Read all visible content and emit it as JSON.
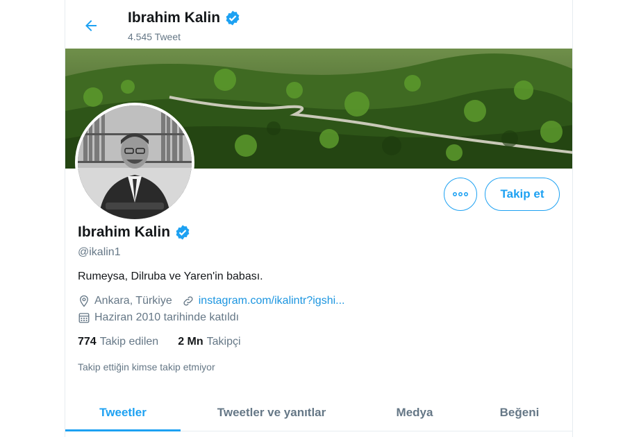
{
  "header": {
    "name": "Ibrahim Kalin",
    "tweet_count": "4.545 Tweet"
  },
  "profile": {
    "name": "Ibrahim Kalin",
    "handle": "@ikalin1",
    "bio": "Rumeysa, Dilruba ve Yaren'in babası.",
    "location": "Ankara, Türkiye",
    "website": "instagram.com/ikalintr?igshi...",
    "joined": "Haziran 2010 tarihinde katıldı",
    "following_count": "774",
    "following_label": "Takip edilen",
    "followers_count": "2 Mn",
    "followers_label": "Takipçi",
    "mutual_note": "Takip ettiğin kimse takip etmiyor"
  },
  "actions": {
    "follow_label": "Takip et"
  },
  "tabs": [
    {
      "label": "Tweetler",
      "active": true
    },
    {
      "label": "Tweetler ve yanıtlar",
      "active": false
    },
    {
      "label": "Medya",
      "active": false
    },
    {
      "label": "Beğeni",
      "active": false
    }
  ],
  "icons": {
    "back": "arrow-left-icon",
    "verified": "verified-badge-icon",
    "more": "more-horizontal-icon",
    "location": "location-pin-icon",
    "link": "link-icon",
    "calendar": "calendar-icon"
  },
  "colors": {
    "accent": "#1da1f2",
    "link": "#1b95e0",
    "muted": "#657786",
    "text": "#14171a"
  }
}
